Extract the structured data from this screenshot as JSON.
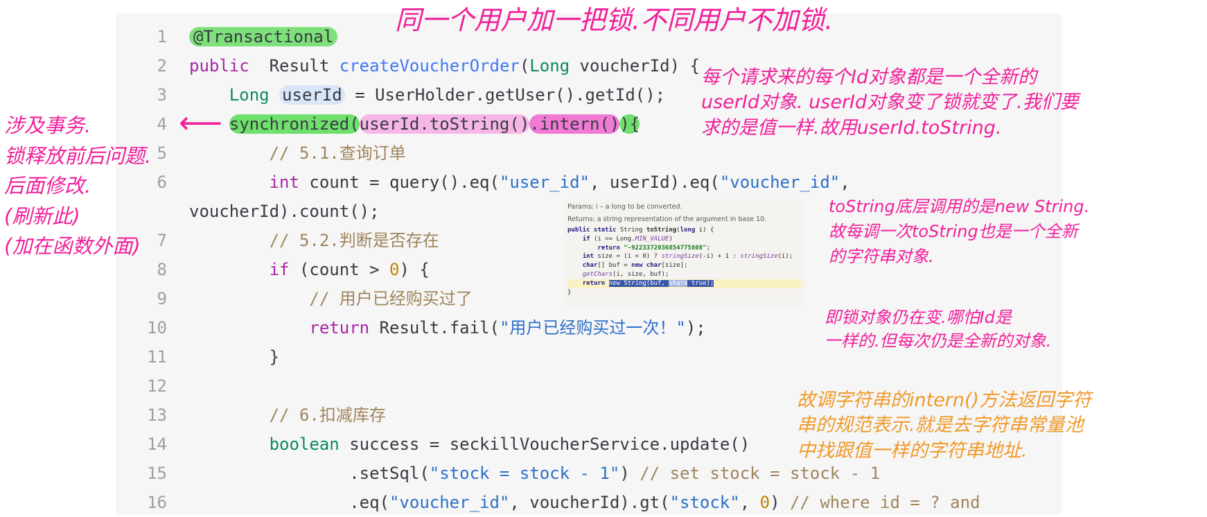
{
  "code_lines": [
    {
      "ln": "1",
      "parts": [
        {
          "t": "@Transactional",
          "c": "anno"
        }
      ]
    },
    {
      "ln": "2",
      "parts": [
        {
          "t": "public",
          "c": "kw"
        },
        {
          "t": "  Result "
        },
        {
          "t": "createVoucherOrder",
          "c": "fn"
        },
        {
          "t": "("
        },
        {
          "t": "Long",
          "c": "ty"
        },
        {
          "t": " voucherId) {"
        }
      ]
    },
    {
      "ln": "3",
      "parts": [
        {
          "t": "    "
        },
        {
          "t": "Long",
          "c": "ty"
        },
        {
          "t": " "
        },
        {
          "t": "userId",
          "c": "hl-blue"
        },
        {
          "t": " = UserHolder.getUser().getId();"
        }
      ]
    },
    {
      "ln": "4",
      "parts": [
        {
          "t": "    "
        },
        {
          "t": "synchronized(",
          "c": "hl-green"
        },
        {
          "t": "userId.toString()",
          "c": "hl-pink"
        },
        {
          "t": ".intern()",
          "c": "hl-magenta"
        },
        {
          "t": "){",
          "c": "hl-green"
        }
      ]
    },
    {
      "ln": "5",
      "parts": [
        {
          "t": "        "
        },
        {
          "t": "// 5.1.查询订单",
          "c": "cm"
        }
      ]
    },
    {
      "ln": "6",
      "parts": [
        {
          "t": "        "
        },
        {
          "t": "int",
          "c": "kw"
        },
        {
          "t": " count = query().eq("
        },
        {
          "t": "\"user_id\"",
          "c": "str"
        },
        {
          "t": ", userId).eq("
        },
        {
          "t": "\"voucher_id\"",
          "c": "str"
        },
        {
          "t": ","
        }
      ]
    },
    {
      "ln": "",
      "parts": [
        {
          "t": "voucherId).count();"
        }
      ]
    },
    {
      "ln": "7",
      "parts": [
        {
          "t": "        "
        },
        {
          "t": "// 5.2.判断是否存在",
          "c": "cm"
        }
      ]
    },
    {
      "ln": "8",
      "parts": [
        {
          "t": "        "
        },
        {
          "t": "if",
          "c": "kw"
        },
        {
          "t": " (count > "
        },
        {
          "t": "0",
          "c": "num"
        },
        {
          "t": ") {"
        }
      ]
    },
    {
      "ln": "9",
      "parts": [
        {
          "t": "            "
        },
        {
          "t": "// 用户已经购买过了",
          "c": "cm"
        }
      ]
    },
    {
      "ln": "10",
      "parts": [
        {
          "t": "            "
        },
        {
          "t": "return",
          "c": "kw"
        },
        {
          "t": " Result.fail("
        },
        {
          "t": "\"用户已经购买过一次！\"",
          "c": "str"
        },
        {
          "t": ");"
        }
      ]
    },
    {
      "ln": "11",
      "parts": [
        {
          "t": "        }"
        }
      ]
    },
    {
      "ln": "12",
      "parts": []
    },
    {
      "ln": "13",
      "parts": [
        {
          "t": "        "
        },
        {
          "t": "// 6.扣减库存",
          "c": "cm"
        }
      ]
    },
    {
      "ln": "14",
      "parts": [
        {
          "t": "        "
        },
        {
          "t": "boolean",
          "c": "ty"
        },
        {
          "t": " success = seckillVoucherService.update()"
        }
      ]
    },
    {
      "ln": "15",
      "parts": [
        {
          "t": "                .setSql("
        },
        {
          "t": "\"stock = stock - 1\"",
          "c": "str"
        },
        {
          "t": ") "
        },
        {
          "t": "// set stock = stock - 1",
          "c": "cm"
        }
      ]
    },
    {
      "ln": "16",
      "parts": [
        {
          "t": "                .eq("
        },
        {
          "t": "\"voucher_id\"",
          "c": "str"
        },
        {
          "t": ", voucherId).gt("
        },
        {
          "t": "\"stock\"",
          "c": "str"
        },
        {
          "t": ", "
        },
        {
          "t": "0",
          "c": "num"
        },
        {
          "t": ") "
        },
        {
          "t": "// where id = ? and",
          "c": "cm"
        }
      ]
    }
  ],
  "annotations": {
    "top": "同一个用户加一把锁.不同用户不加锁.",
    "left": "涉及事务.\n锁释放前后问题.\n后面修改.\n(刷新此)\n(加在函数外面)",
    "right1": "每个请求来的每个Id对象都是一个全新的\nuserId对象. userId对象变了锁就变了.我们要\n求的是值一样.故用userId.toString.",
    "right2": "toString底层调用的是new String.\n故每调一次toString也是一个全新\n的字符串对象.",
    "right3": "即锁对象仍在变.哪怕Id是\n一样的.但每次仍是全新的对象.",
    "right4": "故调字符串的intern()方法返回字符\n串的规范表示.就是去字符串常量池\n中找跟值一样的字符串地址."
  },
  "inset": {
    "params": "Params: i – a long to be converted.",
    "returns": "Returns: a string representation of the argument in base 10."
  }
}
